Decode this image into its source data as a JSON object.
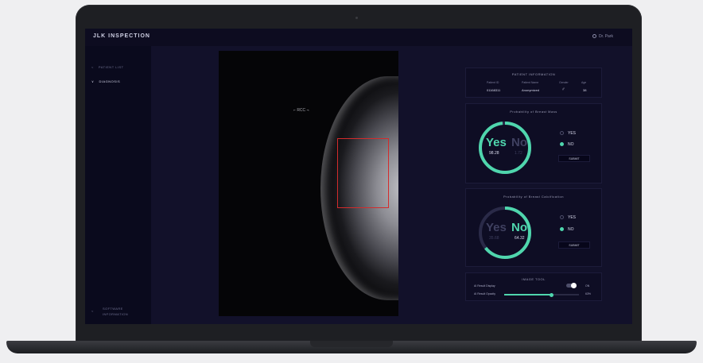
{
  "app": {
    "logo": "JLK INSPECTION",
    "user_label": "Dr. Park"
  },
  "sidebar": {
    "items": [
      {
        "label": "PATIENT LIST",
        "active": false
      },
      {
        "label": "DIAGNOSIS",
        "active": true
      }
    ],
    "software_information": [
      "SOFTWARE",
      "INFORMATION"
    ]
  },
  "viewer": {
    "marker_label": "RCC"
  },
  "patient_info": {
    "title": "PATIENT INFORMATION",
    "headers": [
      "Patient ID",
      "Patient Name",
      "Gender",
      "Age"
    ],
    "values": [
      "01168311",
      "Anonymized",
      "♂",
      "38"
    ]
  },
  "mass": {
    "title": "Probability of Breast Mass",
    "yes_label": "Yes",
    "yes_value": "98.28",
    "no_label": "No",
    "no_value": "1.72",
    "yes_fraction": 0.9828,
    "options": [
      "YES",
      "NO"
    ],
    "selected": "NO",
    "submit_label": "SUBMIT",
    "accent": "#4fd6ad"
  },
  "calc": {
    "title": "Probability of Breast Calcification",
    "yes_label": "Yes",
    "yes_value": "35.68",
    "no_label": "No",
    "no_value": "64.32",
    "no_fraction": 0.6432,
    "options": [
      "YES",
      "NO"
    ],
    "selected": "NO",
    "submit_label": "SUBMIT",
    "accent": "#4fd6ad"
  },
  "image_tools": {
    "title": "IMAGE TOOL",
    "display_label": "AI Result Display",
    "display_value": "ON",
    "opacity_label": "AI Result Opacity",
    "opacity_value": "63%",
    "opacity_fraction": 0.63
  },
  "colors": {
    "accent": "#4fd6ad",
    "background": "#12112a",
    "roi": "#d32b2b"
  }
}
